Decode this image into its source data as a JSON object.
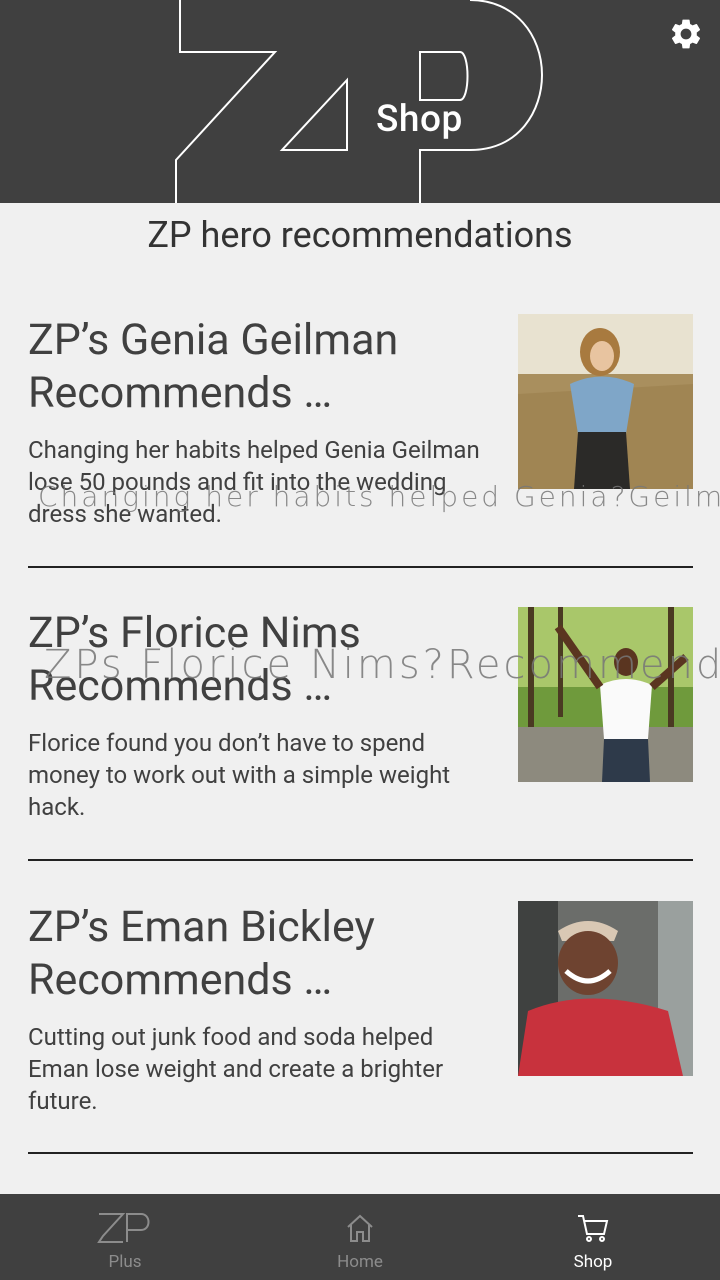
{
  "header": {
    "title": "Shop",
    "settings_icon": "gear-icon"
  },
  "section_title": "ZP hero recommendations",
  "cards": [
    {
      "headline": "ZP’s Genia Geilman Recommends …",
      "description": "Changing her habits helped Genia Geilman lose 50 pounds and fit into the wedding dress she wanted."
    },
    {
      "headline": "ZP’s Florice Nims Recommends …",
      "description": "Florice found you don’t have to spend money to work out with a simple weight hack."
    },
    {
      "headline": "ZP’s Eman Bickley Recommends …",
      "description": "Cutting out junk food and soda helped Eman lose weight and create a brighter future."
    }
  ],
  "overlay_text": {
    "line1": "Changing her habits helped Genia?Geilma",
    "line2": "ZPs Florice Nims?Recommends"
  },
  "bottom_nav": [
    {
      "label": "Plus",
      "icon": "zp-logo-icon"
    },
    {
      "label": "Home",
      "icon": "home-icon"
    },
    {
      "label": "Shop",
      "icon": "cart-icon"
    }
  ],
  "colors": {
    "header_bg": "#404040",
    "page_bg": "#f0f0f0",
    "active_nav": "#ffffff",
    "inactive_nav": "#8c8c8c"
  }
}
